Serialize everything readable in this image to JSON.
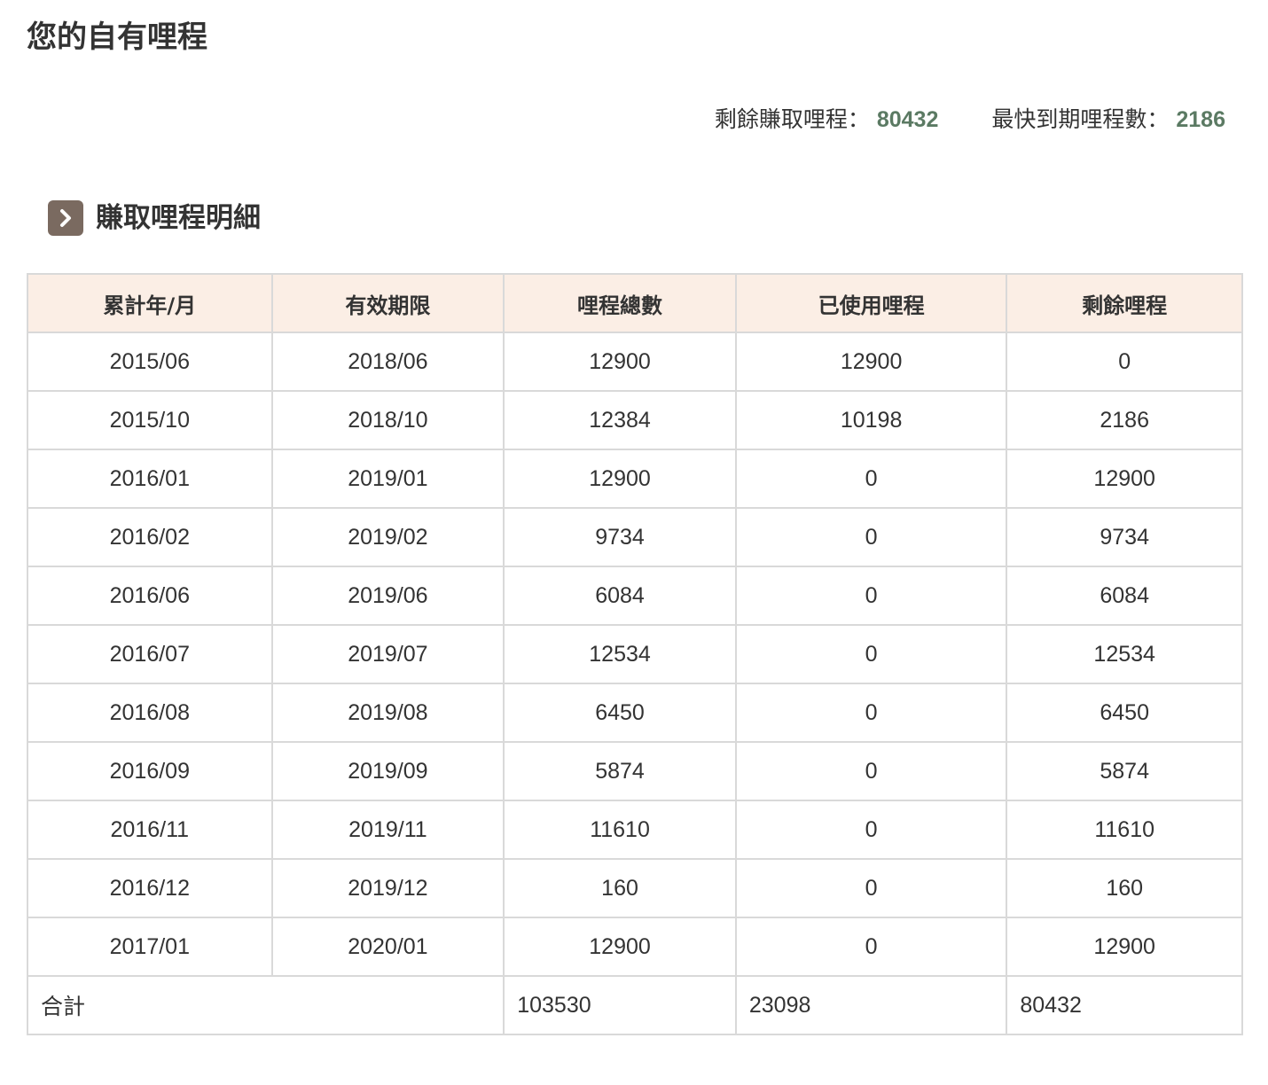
{
  "page": {
    "title": "您的自有哩程"
  },
  "summary": {
    "remaining_label": "剩餘賺取哩程：",
    "remaining_value": "80432",
    "expiring_label": "最快到期哩程數：",
    "expiring_value": "2186"
  },
  "section": {
    "title": "賺取哩程明細",
    "icon": "chevron-right-icon"
  },
  "table": {
    "headers": [
      "累計年/月",
      "有效期限",
      "哩程總數",
      "已使用哩程",
      "剩餘哩程"
    ],
    "rows": [
      [
        "2015/06",
        "2018/06",
        "12900",
        "12900",
        "0"
      ],
      [
        "2015/10",
        "2018/10",
        "12384",
        "10198",
        "2186"
      ],
      [
        "2016/01",
        "2019/01",
        "12900",
        "0",
        "12900"
      ],
      [
        "2016/02",
        "2019/02",
        "9734",
        "0",
        "9734"
      ],
      [
        "2016/06",
        "2019/06",
        "6084",
        "0",
        "6084"
      ],
      [
        "2016/07",
        "2019/07",
        "12534",
        "0",
        "12534"
      ],
      [
        "2016/08",
        "2019/08",
        "6450",
        "0",
        "6450"
      ],
      [
        "2016/09",
        "2019/09",
        "5874",
        "0",
        "5874"
      ],
      [
        "2016/11",
        "2019/11",
        "11610",
        "0",
        "11610"
      ],
      [
        "2016/12",
        "2019/12",
        "160",
        "0",
        "160"
      ],
      [
        "2017/01",
        "2020/01",
        "12900",
        "0",
        "12900"
      ]
    ],
    "total": {
      "label": "合計",
      "total_miles": "103530",
      "used_miles": "23098",
      "remaining_miles": "80432"
    }
  },
  "colors": {
    "accent_value": "#5b7a63",
    "header_bg": "#fbeee5",
    "icon_bg": "#7a6a60",
    "border": "#d9d9d9"
  }
}
